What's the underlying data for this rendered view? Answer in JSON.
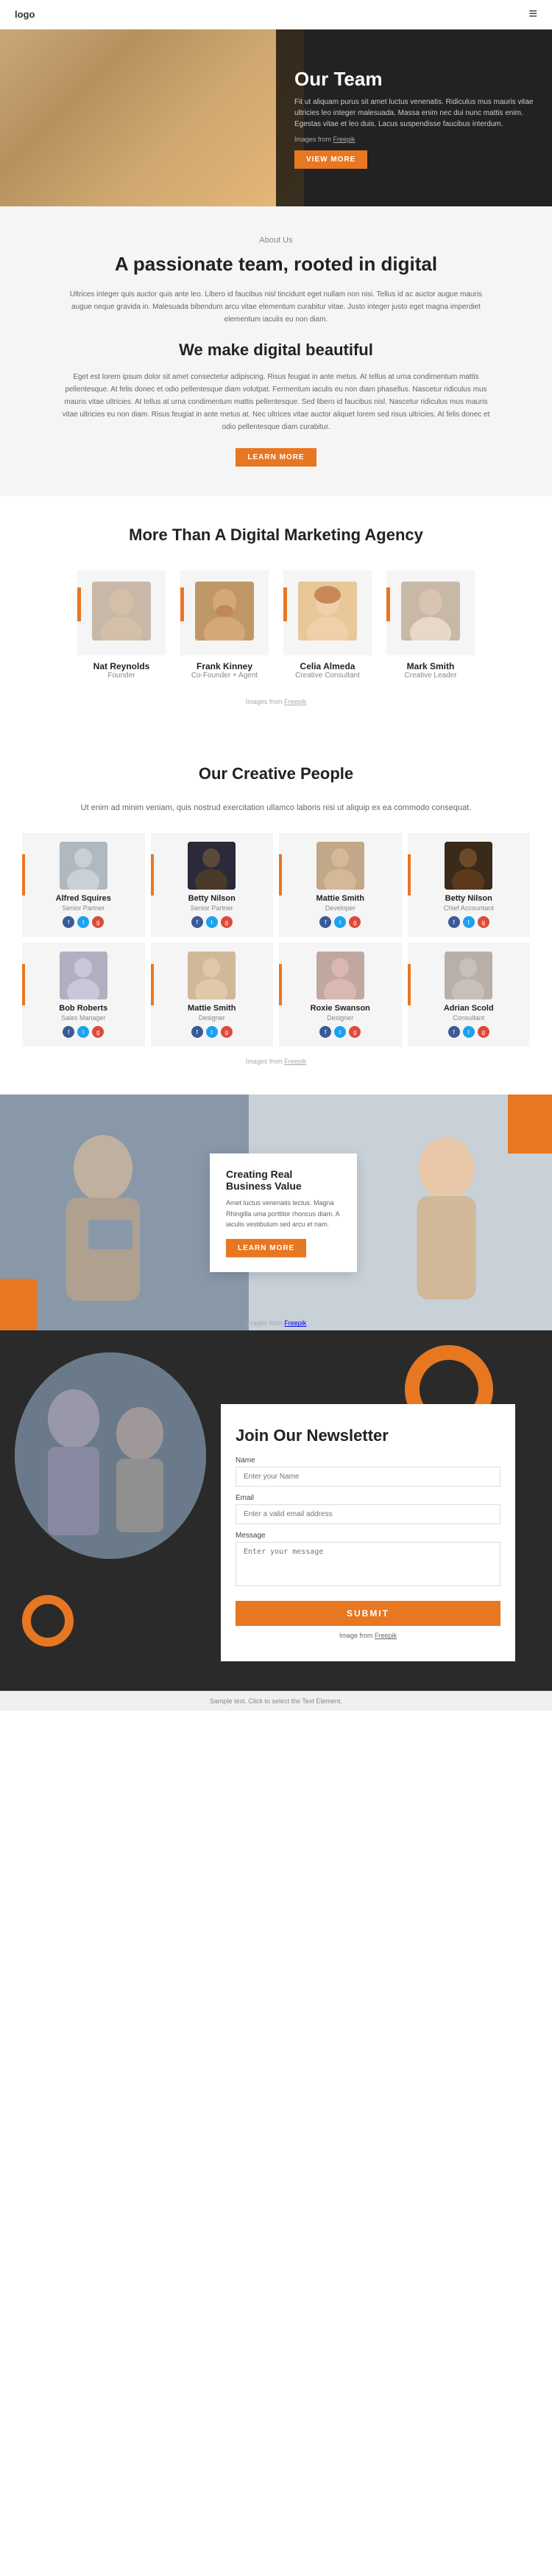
{
  "navbar": {
    "logo": "logo",
    "menu_icon": "≡"
  },
  "hero": {
    "title": "Our Team",
    "description": "Fit ut aliquam purus sit amet luctus venenatis. Ridiculus mus mauris vitae ultricies leo integer malesuada. Massa enim nec dui nunc mattis enim. Egestas vitae et leo duis. Lacus suspendisse faucibus interdum.",
    "image_source": "Images from",
    "image_source_link": "Freepik",
    "view_more": "VIEW MORE"
  },
  "about": {
    "label": "About Us",
    "title": "A passionate team, rooted in digital",
    "text1": "Ultrices integer quis auctor quis ante leo. Libero id faucibus nisl tincidunt eget nullam non nisi. Tellus id ac auctor augue mauris augue neque gravida in. Malesuada bibendum arcu vitae elementum curabitur vitae. Justo integer justo eget magna imperdiet elementum iaculis eu non diam.",
    "subtitle": "We make digital beautiful",
    "text2": "Eget est lorem ipsum dolor sit amet consectetur adipiscing. Risus feugiat in ante metus. At tellus at urna condimentum mattis pellentesque. At felis donec et odio pellentesque diam volutpat. Fermentum iaculis eu non diam phasellus. Nascetur ridiculus mus mauris vitae ultricies. At tellus at urna condimentum mattis pellentesque. Sed libero id faucibus nisl. Nascetur ridiculus mus mauris vitae ultricies eu non diam. Risus feugiat in ante metus at. Nec ultrices vitae auctor aliquet lorem sed risus ultricies. At felis donec et odio pellentesque diam curabitur.",
    "learn_more": "LEARN MORE"
  },
  "team_section": {
    "title": "More Than A Digital Marketing Agency",
    "members": [
      {
        "name": "Nat Reynolds",
        "role": "Founder",
        "avatar_class": "av-nat"
      },
      {
        "name": "Frank Kinney",
        "role": "Co-Founder + Agent",
        "avatar_class": "av-frank"
      },
      {
        "name": "Celia Almeda",
        "role": "Creative Consultant",
        "avatar_class": "av-celia"
      },
      {
        "name": "Mark Smith",
        "role": "Creative Leader",
        "avatar_class": "av-mark"
      }
    ],
    "image_source": "Images from",
    "image_source_link": "Freepik"
  },
  "creative_section": {
    "title": "Our Creative People",
    "description": "Ut enim ad minim veniam, quis nostrud exercitation ullamco laboris nisi ut aliquip ex ea commodo consequat.",
    "members": [
      {
        "name": "Alfred Squires",
        "role": "Senior Partner",
        "avatar_class": "av-alfred"
      },
      {
        "name": "Betty Nilson",
        "role": "Senior Partner",
        "avatar_class": "av-betty1"
      },
      {
        "name": "Mattie Smith",
        "role": "Developer",
        "avatar_class": "av-mattie1"
      },
      {
        "name": "Betty Nilson",
        "role": "Chief Accountant",
        "avatar_class": "av-betty2"
      },
      {
        "name": "Bob Roberts",
        "role": "Sales Manager",
        "avatar_class": "av-bob"
      },
      {
        "name": "Mattie Smith",
        "role": "Designer",
        "avatar_class": "av-mattie2"
      },
      {
        "name": "Roxie Swanson",
        "role": "Designer",
        "avatar_class": "av-roxie"
      },
      {
        "name": "Adrian Scold",
        "role": "Consultant",
        "avatar_class": "av-adrian"
      }
    ],
    "image_source": "Images from",
    "image_source_link": "Freepik"
  },
  "business": {
    "card_title": "Creating Real Business Value",
    "card_text": "Amet luctus venenatis lectus. Magna Rhingilla uma porttitor rhoncus diam. A iaculis vestibulum sed arcu et nam.",
    "learn_more": "LEARN MORE",
    "image_source": "Images from",
    "image_source_link": "Freepik"
  },
  "newsletter": {
    "title": "Join Our Newsletter",
    "name_label": "Name",
    "name_placeholder": "Enter your Name",
    "email_label": "Email",
    "email_placeholder": "Enter a valid email address",
    "message_label": "Message",
    "message_placeholder": "Enter your message",
    "submit": "SUBMIT",
    "image_source": "Image from",
    "image_source_link": "Freepik"
  },
  "footer": {
    "text": "Sample text. Click to select the Text Element."
  }
}
